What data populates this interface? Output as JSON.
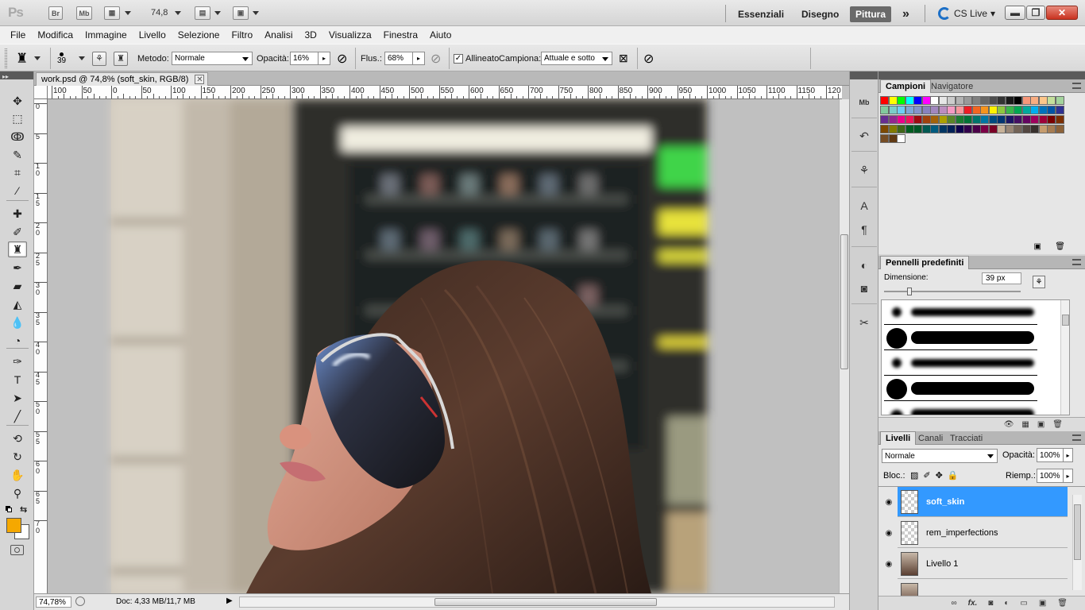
{
  "appbar": {
    "logo": "Ps",
    "bridge": "Br",
    "minibridge": "Mb",
    "zoom": "74,8",
    "workspaces": [
      "Essenziali",
      "Disegno",
      "Pittura"
    ],
    "active_workspace": "Pittura",
    "more": "»",
    "cslive": "CS Live",
    "cslive_arrow": "▾",
    "win": {
      "minimize": "▬",
      "restore": "❐",
      "close": "✕"
    }
  },
  "menu": [
    "File",
    "Modifica",
    "Immagine",
    "Livello",
    "Selezione",
    "Filtro",
    "Analisi",
    "3D",
    "Visualizza",
    "Finestra",
    "Aiuto"
  ],
  "options": {
    "brush_size": "39",
    "method_label": "Metodo:",
    "method_value": "Normale",
    "opacity_label": "Opacità:",
    "opacity_value": "16%",
    "flow_label": "Flus.:",
    "flow_value": "68%",
    "aligned_label": "Allineato",
    "aligned_checked": "✓",
    "sample_label": "Campiona:",
    "sample_value": "Attuale e sotto",
    "arrow": "▸"
  },
  "document": {
    "tab_title": "work.psd @ 74,8% (soft_skin, RGB/8)",
    "close": "✕",
    "ruler_h": [
      "100",
      "50",
      "0",
      "50",
      "100",
      "150",
      "200",
      "250",
      "300",
      "350",
      "400",
      "450",
      "500",
      "550",
      "600",
      "650",
      "700",
      "750",
      "800",
      "850",
      "900",
      "950",
      "1000",
      "1050",
      "1100",
      "1150",
      "120"
    ],
    "ruler_v": [
      "0",
      "5",
      "10",
      "15",
      "20",
      "25",
      "30",
      "35",
      "40",
      "45",
      "50",
      "55",
      "60",
      "65",
      "70"
    ],
    "status_zoom": "74,78%",
    "status_doc": "Doc: 4,33 MB/11,7 MB",
    "status_arrow": "▶"
  },
  "tools": [
    {
      "name": "move-tool",
      "glyph": "✥"
    },
    {
      "name": "marquee-tool",
      "glyph": "⬚"
    },
    {
      "name": "lasso-tool",
      "glyph": "ↂ"
    },
    {
      "name": "quick-select-tool",
      "glyph": "✎"
    },
    {
      "name": "crop-tool",
      "glyph": "⌗"
    },
    {
      "name": "eyedropper-tool",
      "glyph": "⁄"
    },
    {
      "name": "healing-brush-tool",
      "glyph": "✚"
    },
    {
      "name": "brush-tool",
      "glyph": "✐"
    },
    {
      "name": "clone-stamp-tool",
      "glyph": "♜"
    },
    {
      "name": "history-brush-tool",
      "glyph": "✒"
    },
    {
      "name": "eraser-tool",
      "glyph": "▰"
    },
    {
      "name": "paint-bucket-tool",
      "glyph": "◭"
    },
    {
      "name": "blur-tool",
      "glyph": "💧"
    },
    {
      "name": "dodge-tool",
      "glyph": "◔"
    },
    {
      "name": "pen-tool",
      "glyph": "✑"
    },
    {
      "name": "type-tool",
      "glyph": "T"
    },
    {
      "name": "path-select-tool",
      "glyph": "➤"
    },
    {
      "name": "line-tool",
      "glyph": "╱"
    },
    {
      "name": "3d-rotate-tool",
      "glyph": "⟲"
    },
    {
      "name": "3d-orbit-tool",
      "glyph": "↻"
    },
    {
      "name": "hand-tool",
      "glyph": "✋"
    },
    {
      "name": "zoom-tool",
      "glyph": "⚲"
    }
  ],
  "colors": {
    "foreground": "#f5a800",
    "background": "#ffffff",
    "selection": "#3399ff",
    "panel_dark": "#5a5a5a"
  },
  "swatches_panel": {
    "tabs": [
      "Campioni",
      "Navigatore"
    ],
    "swatches": [
      "#ff0000",
      "#ffff00",
      "#00ff00",
      "#00ffff",
      "#0000ff",
      "#ff00ff",
      "#ffffff",
      "#e6e6e6",
      "#cccccc",
      "#b3b3b3",
      "#999999",
      "#808080",
      "#666666",
      "#4d4d4d",
      "#333333",
      "#1a1a1a",
      "#000000",
      "#f7977a",
      "#f9ad81",
      "#fdc68a",
      "#c4df9b",
      "#a3d39c",
      "#82ca9d",
      "#7bcdc8",
      "#6ecff6",
      "#7ea7d8",
      "#8493ca",
      "#8882be",
      "#a187be",
      "#bc8dbf",
      "#f49ac2",
      "#f6989d",
      "#ed1c24",
      "#f26522",
      "#f7941d",
      "#fff200",
      "#8dc63f",
      "#39b54a",
      "#00a651",
      "#00a99d",
      "#00aeef",
      "#0072bc",
      "#0054a6",
      "#2e3192",
      "#662d91",
      "#92278f",
      "#ec008c",
      "#ed145b",
      "#9e0b0f",
      "#a0410d",
      "#a36209",
      "#aba000",
      "#598527",
      "#1a7b30",
      "#007236",
      "#00746b",
      "#0076a3",
      "#004b80",
      "#003471",
      "#1b1464",
      "#440e62",
      "#630460",
      "#9e005d",
      "#9e0039",
      "#790000",
      "#7b2e00",
      "#7d4900",
      "#827b00",
      "#406618",
      "#005e20",
      "#005826",
      "#005952",
      "#005b7f",
      "#003663",
      "#002157",
      "#0d004c",
      "#32004b",
      "#4b0049",
      "#7b0046",
      "#7a0026",
      "#c7b299",
      "#998675",
      "#736357",
      "#534741",
      "#37302d",
      "#c69c6d",
      "#a67c52",
      "#8c6239",
      "#754c24",
      "#603913",
      "#ffffff"
    ],
    "footer_icons": [
      "new-swatch-icon",
      "trash-icon"
    ]
  },
  "brushes_panel": {
    "title": "Pennelli predefiniti",
    "size_label": "Dimensione:",
    "size_value": "39 px"
  },
  "layers_panel": {
    "tabs": [
      "Livelli",
      "Canali",
      "Tracciati"
    ],
    "blend_mode": "Normale",
    "opacity_label": "Opacità:",
    "opacity_value": "100%",
    "lock_label": "Bloc.:",
    "fill_label": "Riemp.:",
    "fill_value": "100%",
    "layers": [
      {
        "name": "soft_skin",
        "selected": true,
        "type": "transparent"
      },
      {
        "name": "rem_imperfections",
        "selected": false,
        "type": "transparent"
      },
      {
        "name": "Livello 1",
        "selected": false,
        "type": "photo"
      }
    ],
    "eye": "◉",
    "footer": [
      "∞",
      "fx.",
      "◙",
      "◐",
      "▭",
      "▣",
      "🗑"
    ]
  }
}
